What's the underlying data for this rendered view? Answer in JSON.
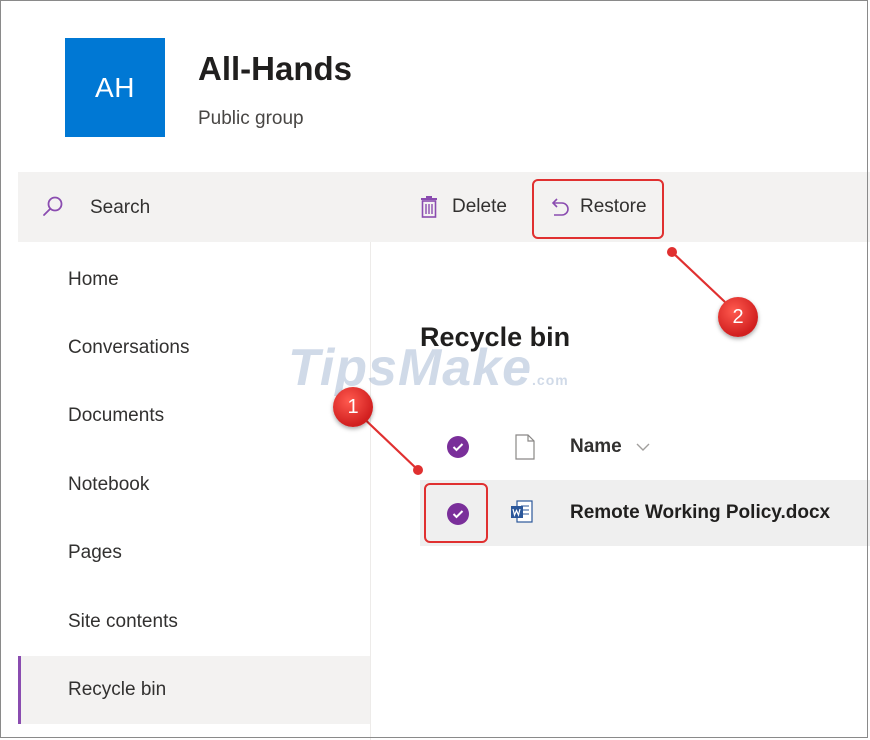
{
  "header": {
    "avatar_initials": "AH",
    "site_title": "All-Hands",
    "site_subtitle": "Public group",
    "brand_color": "#0078d4"
  },
  "commandbar": {
    "search_label": "Search",
    "delete_label": "Delete",
    "restore_label": "Restore"
  },
  "nav": {
    "items": [
      {
        "label": "Home"
      },
      {
        "label": "Conversations"
      },
      {
        "label": "Documents"
      },
      {
        "label": "Notebook"
      },
      {
        "label": "Pages"
      },
      {
        "label": "Site contents"
      },
      {
        "label": "Recycle bin",
        "active": true
      }
    ]
  },
  "main": {
    "title": "Recycle bin",
    "column_name": "Name",
    "files": [
      {
        "name": "Remote Working Policy.docx",
        "selected": true,
        "icon": "word-doc-icon"
      }
    ]
  },
  "annotations": {
    "step1": "1",
    "step2": "2",
    "color": "#e03030"
  },
  "watermark": {
    "text": "TipsMake",
    "suffix": ".com"
  }
}
